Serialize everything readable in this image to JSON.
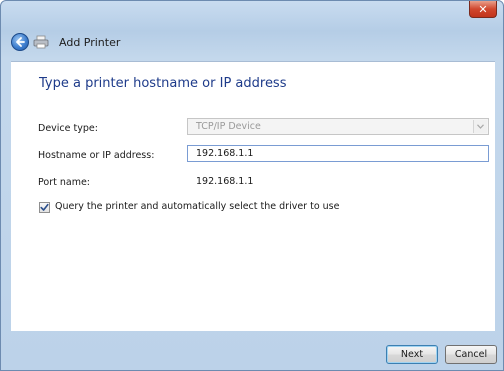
{
  "window": {
    "title": "Add Printer",
    "close_label": "✕"
  },
  "page": {
    "heading": "Type a printer hostname or IP address"
  },
  "form": {
    "device_type": {
      "label": "Device type:",
      "value": "TCP/IP Device"
    },
    "hostname": {
      "label": "Hostname or IP address:",
      "value": "192.168.1.1"
    },
    "port_name": {
      "label": "Port name:",
      "value": "192.168.1.1"
    },
    "query_checkbox": {
      "label": "Query the printer and automatically select the driver to use",
      "checked": true
    }
  },
  "buttons": {
    "next": "Next",
    "cancel": "Cancel"
  },
  "colors": {
    "heading": "#1e3b8a",
    "frame": "#bcd2e9",
    "close": "#d0472e"
  }
}
